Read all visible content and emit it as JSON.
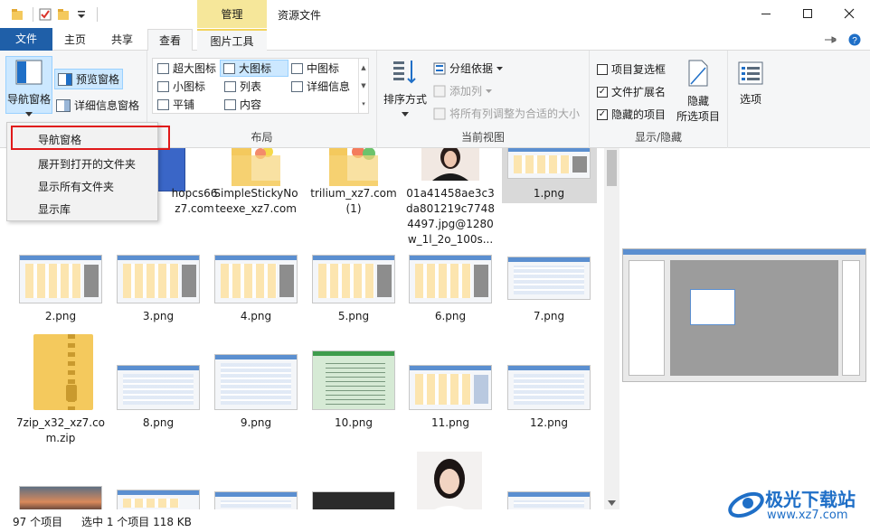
{
  "window": {
    "title": "资源文件",
    "context_group": "管理",
    "controls": [
      "minimize",
      "maximize",
      "close"
    ]
  },
  "tabs": [
    {
      "label": "文件"
    },
    {
      "label": "主页"
    },
    {
      "label": "共享"
    },
    {
      "label": "查看"
    },
    {
      "label": "图片工具"
    }
  ],
  "ribbon": {
    "panes": {
      "label": "导航窗格",
      "preview": "预览窗格",
      "details": "详细信息窗格"
    },
    "layout": {
      "label": "布局",
      "items": [
        "超大图标",
        "大图标",
        "中图标",
        "小图标",
        "列表",
        "详细信息",
        "平铺",
        "内容"
      ],
      "selected": "大图标"
    },
    "current_view": {
      "label": "当前视图",
      "sort": "排序方式",
      "group": "分组依据",
      "add_column": "添加列",
      "fit_columns": "将所有列调整为合适的大小"
    },
    "show_hide": {
      "label": "显示/隐藏",
      "item_checkboxes": "项目复选框",
      "file_extensions": "文件扩展名",
      "hidden_items": "隐藏的项目",
      "hide_selected_line1": "隐藏",
      "hide_selected_line2": "所选项目",
      "checks": {
        "item_checkboxes": false,
        "file_extensions": true,
        "hidden_items": true
      }
    },
    "options": "选项"
  },
  "dropdown": {
    "items": [
      "导航窗格",
      "展开到打开的文件夹",
      "显示所有文件夹",
      "显示库"
    ]
  },
  "files": {
    "row1": [
      {
        "line1": "hopcs66",
        "line2": "z7.com"
      },
      {
        "line1": "SimpleStickyNo",
        "line2": "teexe_xz7.com"
      },
      {
        "line1": "trilium_xz7.com",
        "line2": "(1)"
      },
      {
        "line1": "01a41458ae3c3",
        "line2": "da801219c7748",
        "line3": "4497.jpg@1280",
        "line4": "w_1l_2o_100s..."
      },
      {
        "line1": "1.png"
      }
    ],
    "row2": [
      "2.png",
      "3.png",
      "4.png",
      "5.png",
      "6.png",
      "7.png"
    ],
    "row3": [
      {
        "line1": "7zip_x32_xz7.co",
        "line2": "m.zip"
      },
      {
        "line1": "8.png"
      },
      {
        "line1": "9.png"
      },
      {
        "line1": "10.png"
      },
      {
        "line1": "11.png"
      },
      {
        "line1": "12.png"
      }
    ]
  },
  "status": {
    "count": "97 个项目",
    "selected": "选中 1 个项目  118 KB"
  },
  "watermark": {
    "text": "极光下载站",
    "url": "www.xz7.com"
  },
  "colors": {
    "file_tab": "#1f5fa8",
    "context_tab": "#f6e79a",
    "highlight": "#e0191a",
    "selected_layout": "#cce8ff"
  }
}
